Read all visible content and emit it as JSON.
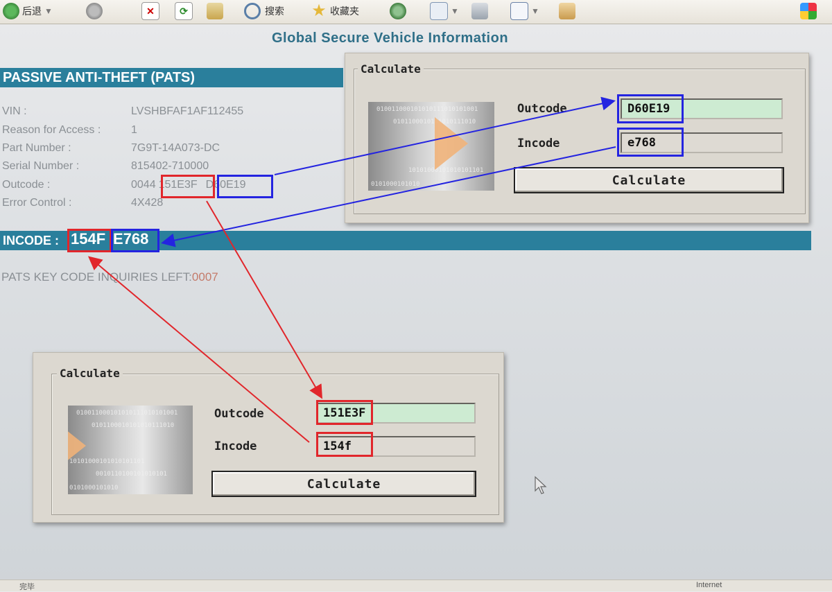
{
  "browser": {
    "back_label": "后退",
    "search_label": "搜索",
    "favorites_label": "收藏夹",
    "status_left": "完毕",
    "status_right": "Internet"
  },
  "page": {
    "title": "Global Secure Vehicle Information",
    "pats_header": "PASSIVE ANTI-THEFT (PATS)",
    "fields": [
      {
        "label": "VIN :",
        "value": "LVSHBFAF1AF112455"
      },
      {
        "label": "Reason for Access :",
        "value": "1"
      },
      {
        "label": "Part Number :",
        "value": "7G9T-14A073-DC"
      },
      {
        "label": "Serial Number :",
        "value": "815402-710000"
      },
      {
        "label": "Error Control :",
        "value": "4X428"
      }
    ],
    "outcode": {
      "label": "Outcode :",
      "prefix": "0044",
      "part1": "151E3F",
      "part2": "D60E19"
    },
    "incode": {
      "label": "INCODE :",
      "part1": "154F",
      "part2": "E768"
    },
    "inquiries_label": "PATS KEY CODE INQUIRIES LEFT:",
    "inquiries_count": "0007"
  },
  "dialog_top": {
    "title": "Calculate",
    "outcode_label": "Outcode",
    "outcode_value": "D60E19",
    "incode_label": "Incode",
    "incode_value": "e768",
    "button": "Calculate"
  },
  "dialog_bottom": {
    "title": "Calculate",
    "outcode_label": "Outcode",
    "outcode_value": "151E3F",
    "incode_label": "Incode",
    "incode_value": "154f",
    "button": "Calculate"
  },
  "art_bits": [
    "010011000101010111010101001",
    "0101100010101010111010",
    "10101000101010101101",
    "0101000101010",
    "0010110100101010101"
  ],
  "colors": {
    "band": "#2a7f9c",
    "highlight_red": "#e1262b",
    "highlight_blue": "#2424e0",
    "outcode_field": "#cdebd2"
  }
}
